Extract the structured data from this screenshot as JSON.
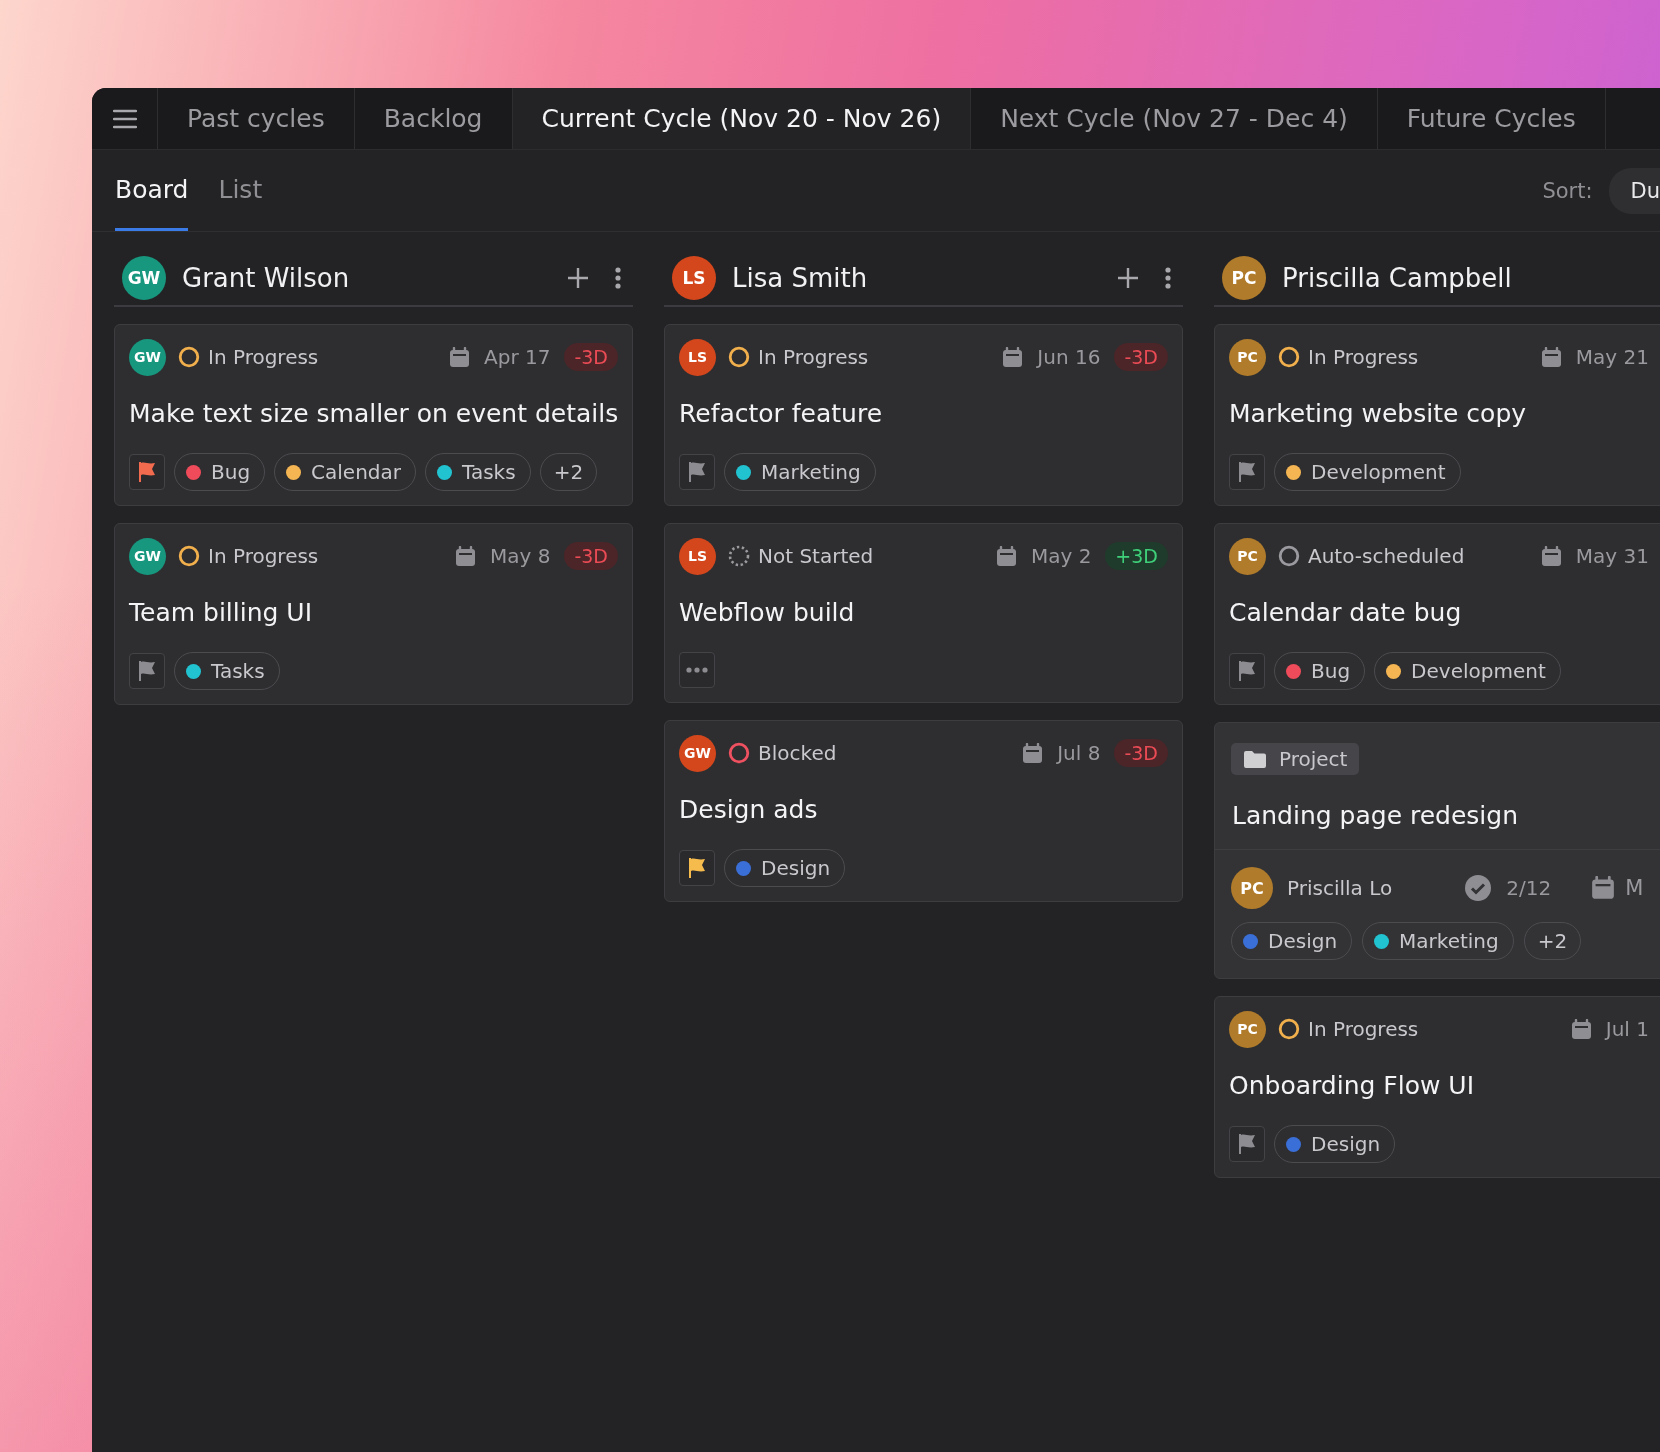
{
  "tabs": [
    {
      "label": "Past cycles",
      "selected": false
    },
    {
      "label": "Backlog",
      "selected": false
    },
    {
      "label": "Current Cycle (Nov 20 - Nov 26)",
      "selected": true
    },
    {
      "label": "Next Cycle (Nov 27 - Dec 4)",
      "selected": false
    },
    {
      "label": "Future Cycles",
      "selected": false
    }
  ],
  "views": [
    {
      "label": "Board",
      "selected": true
    },
    {
      "label": "List",
      "selected": false
    }
  ],
  "sort": {
    "label": "Sort:",
    "value": "Du"
  },
  "columns": [
    {
      "initials": "GW",
      "color": "#17977e",
      "name": "Grant Wilson",
      "cards": [
        {
          "kind": "task",
          "assignee": {
            "initials": "GW",
            "color": "#17977e"
          },
          "status": {
            "kind": "in_progress",
            "label": "In Progress"
          },
          "date": "Apr 17",
          "offset": {
            "kind": "late",
            "text": "-3D"
          },
          "title": "Make text size smaller on event details",
          "flag": {
            "kind": "urgent"
          },
          "tags": [
            {
              "label": "Bug",
              "color": "#ef4b5a"
            },
            {
              "label": "Calendar",
              "color": "#f4b552"
            },
            {
              "label": "Tasks",
              "color": "#22c3d0"
            }
          ],
          "more": "+2"
        },
        {
          "kind": "task",
          "assignee": {
            "initials": "GW",
            "color": "#17977e"
          },
          "status": {
            "kind": "in_progress",
            "label": "In Progress"
          },
          "date": "May 8",
          "offset": {
            "kind": "late",
            "text": "-3D"
          },
          "title": "Team billing UI",
          "flag": {
            "kind": "normal"
          },
          "tags": [
            {
              "label": "Tasks",
              "color": "#22c3d0"
            }
          ]
        }
      ]
    },
    {
      "initials": "LS",
      "color": "#d4461c",
      "name": "Lisa Smith",
      "cards": [
        {
          "kind": "task",
          "assignee": {
            "initials": "LS",
            "color": "#d4461c"
          },
          "status": {
            "kind": "in_progress",
            "label": "In Progress"
          },
          "date": "Jun 16",
          "offset": {
            "kind": "late",
            "text": "-3D"
          },
          "title": "Refactor feature",
          "flag": {
            "kind": "normal"
          },
          "tags": [
            {
              "label": "Marketing",
              "color": "#22c3d0"
            }
          ]
        },
        {
          "kind": "task",
          "assignee": {
            "initials": "LS",
            "color": "#d4461c"
          },
          "status": {
            "kind": "not_started",
            "label": "Not Started"
          },
          "date": "May 2",
          "offset": {
            "kind": "early",
            "text": "+3D"
          },
          "title": "Webflow build",
          "flag": {
            "kind": "unset"
          }
        },
        {
          "kind": "task",
          "assignee": {
            "initials": "GW",
            "color": "#d4461c"
          },
          "status": {
            "kind": "blocked",
            "label": "Blocked"
          },
          "date": "Jul 8",
          "offset": {
            "kind": "late",
            "text": "-3D"
          },
          "title": "Design ads",
          "flag": {
            "kind": "high"
          },
          "tags": [
            {
              "label": "Design",
              "color": "#3a6fd8"
            }
          ]
        }
      ]
    },
    {
      "initials": "PC",
      "color": "#b07b2a",
      "name": "Priscilla Campbell",
      "cards": [
        {
          "kind": "task",
          "assignee": {
            "initials": "PC",
            "color": "#b07b2a"
          },
          "status": {
            "kind": "in_progress",
            "label": "In Progress"
          },
          "date": "May 21",
          "title": "Marketing website copy",
          "flag": {
            "kind": "normal"
          },
          "tags": [
            {
              "label": "Development",
              "color": "#f4b552"
            }
          ]
        },
        {
          "kind": "task",
          "assignee": {
            "initials": "PC",
            "color": "#b07b2a"
          },
          "status": {
            "kind": "auto_scheduled",
            "label": "Auto-scheduled"
          },
          "date": "May 31",
          "title": "Calendar date bug",
          "flag": {
            "kind": "normal"
          },
          "tags": [
            {
              "label": "Bug",
              "color": "#ef4b5a"
            },
            {
              "label": "Development",
              "color": "#f4b552"
            }
          ]
        },
        {
          "kind": "project",
          "badge": "Project",
          "title": "Landing page redesign",
          "owner": {
            "initials": "PC",
            "color": "#b07b2a",
            "name": "Priscilla Lo"
          },
          "progress": "2/12",
          "date": "M",
          "tags": [
            {
              "label": "Design",
              "color": "#3a6fd8"
            },
            {
              "label": "Marketing",
              "color": "#22c3d0"
            }
          ],
          "more": "+2"
        },
        {
          "kind": "task",
          "assignee": {
            "initials": "PC",
            "color": "#b07b2a"
          },
          "status": {
            "kind": "in_progress",
            "label": "In Progress"
          },
          "date": "Jul 1",
          "title": "Onboarding Flow UI",
          "flag": {
            "kind": "normal"
          },
          "tags": [
            {
              "label": "Design",
              "color": "#3a6fd8"
            }
          ]
        }
      ]
    }
  ]
}
